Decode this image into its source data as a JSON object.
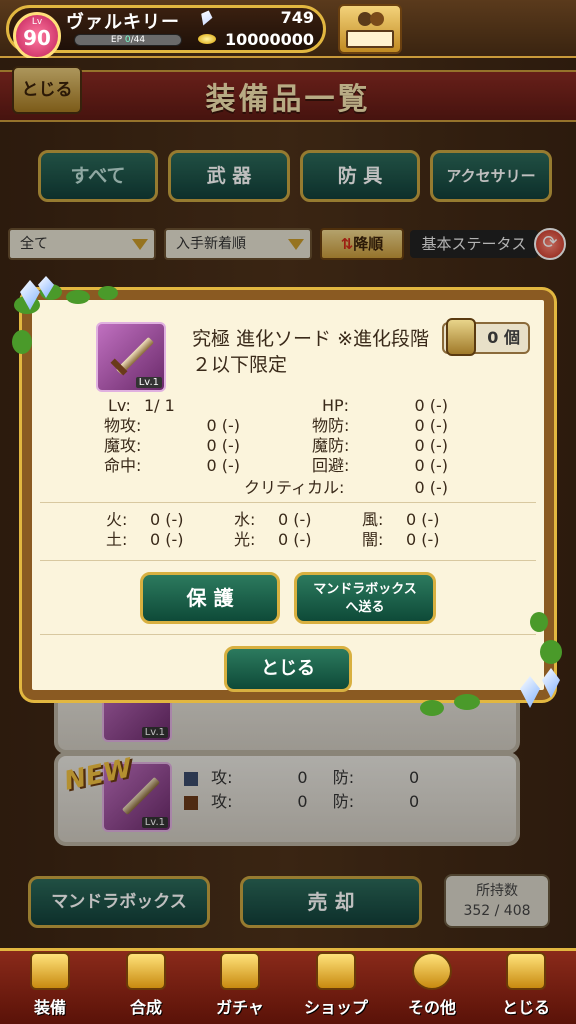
{
  "player": {
    "lv_label": "Lv",
    "level": "90",
    "name": "ヴァルキリー",
    "ep_label": "EP",
    "ep_current": "0",
    "ep_max": "/44",
    "gems": "749",
    "gold": "10000000"
  },
  "header": {
    "close_label": "とじる",
    "title": "装備品一覧"
  },
  "tabs": [
    {
      "label": "すべて"
    },
    {
      "label": "武 器"
    },
    {
      "label": "防 具"
    },
    {
      "label": "アクセサリー"
    }
  ],
  "filters": {
    "category": "全て",
    "sort": "入手新着順",
    "order_label": "降順",
    "stat_label": "基本ステータス"
  },
  "list": [
    {
      "lv": "Lv.1",
      "new": "",
      "row1": {
        "atk": "",
        "def": ""
      }
    },
    {
      "lv": "Lv.1",
      "new": "NEW",
      "row1": {
        "atk_label": "攻:",
        "atk": "0",
        "def_label": "防:",
        "def": "0"
      },
      "row2": {
        "atk_label": "攻:",
        "atk": "0",
        "def_label": "防:",
        "def": "0"
      }
    }
  ],
  "bottom": {
    "mandra_label": "マンドラボックス",
    "sell_label": "売 却",
    "count_label": "所持数",
    "count_value": "352 / 408"
  },
  "nav": [
    {
      "label": "装備"
    },
    {
      "label": "合成"
    },
    {
      "label": "ガチャ"
    },
    {
      "label": "ショップ"
    },
    {
      "label": "その他"
    },
    {
      "label": "とじる"
    }
  ],
  "modal": {
    "item_name": "究極 進化ソード ※進化段階２以下限定",
    "item_lv": "Lv.1",
    "owned": "0 個",
    "lv_label": "Lv:",
    "lv_value": "1/ 1",
    "hp_label": "HP:",
    "hp_value": "0 (-)",
    "patk_label": "物攻:",
    "patk_value": "0 (-)",
    "pdef_label": "物防:",
    "pdef_value": "0 (-)",
    "matk_label": "魔攻:",
    "matk_value": "0 (-)",
    "mdef_label": "魔防:",
    "mdef_value": "0 (-)",
    "hit_label": "命中:",
    "hit_value": "0 (-)",
    "eva_label": "回避:",
    "eva_value": "0 (-)",
    "crit_label": "クリティカル:",
    "crit_value": "0 (-)",
    "fire_label": "火:",
    "fire_value": "0 (-)",
    "water_label": "水:",
    "water_value": "0 (-)",
    "wind_label": "風:",
    "wind_value": "0 (-)",
    "earth_label": "土:",
    "earth_value": "0 (-)",
    "light_label": "光:",
    "light_value": "0 (-)",
    "dark_label": "闇:",
    "dark_value": "0 (-)",
    "protect_label": "保 護",
    "send_label_1": "マンドラボックス",
    "send_label_2": "へ送る",
    "close_label": "とじる"
  }
}
